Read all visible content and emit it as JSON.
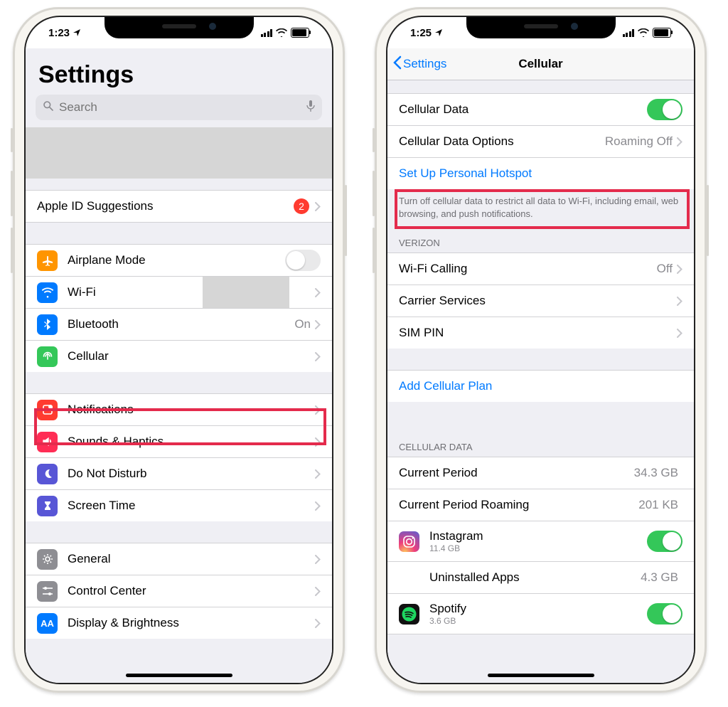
{
  "left": {
    "time": "1:23",
    "title": "Settings",
    "search_placeholder": "Search",
    "apple_id": {
      "label": "Apple ID Suggestions",
      "badge": "2"
    },
    "group1": [
      {
        "icon": "airplane",
        "color": "#ff9500",
        "label": "Airplane Mode",
        "type": "toggle",
        "on": false
      },
      {
        "icon": "wifi",
        "color": "#007aff",
        "label": "Wi-Fi",
        "type": "grey"
      },
      {
        "icon": "bluetooth",
        "color": "#007aff",
        "label": "Bluetooth",
        "type": "disclose",
        "value": "On"
      },
      {
        "icon": "cellular",
        "color": "#34c759",
        "label": "Cellular",
        "type": "disclose",
        "highlight": true
      }
    ],
    "group2": [
      {
        "icon": "notify",
        "color": "#ff3b30",
        "label": "Notifications"
      },
      {
        "icon": "sounds",
        "color": "#ff2d55",
        "label": "Sounds & Haptics"
      },
      {
        "icon": "moon",
        "color": "#5856d6",
        "label": "Do Not Disturb"
      },
      {
        "icon": "hourglass",
        "color": "#5856d6",
        "label": "Screen Time"
      }
    ],
    "group3": [
      {
        "icon": "gear",
        "color": "#8e8e93",
        "label": "General"
      },
      {
        "icon": "sliders",
        "color": "#8e8e93",
        "label": "Control Center"
      },
      {
        "icon": "aa",
        "color": "#007aff",
        "label": "Display & Brightness"
      }
    ]
  },
  "right": {
    "time": "1:25",
    "back": "Settings",
    "title": "Cellular",
    "row1": {
      "label": "Cellular Data",
      "on": true
    },
    "row2": {
      "label": "Cellular Data Options",
      "value": "Roaming Off",
      "highlight": true
    },
    "row3": {
      "label": "Set Up Personal Hotspot"
    },
    "note": "Turn off cellular data to restrict all data to Wi-Fi, including email, web browsing, and push notifications.",
    "carrier_header": "VERIZON",
    "carrier_rows": [
      {
        "label": "Wi-Fi Calling",
        "value": "Off"
      },
      {
        "label": "Carrier Services"
      },
      {
        "label": "SIM PIN"
      }
    ],
    "add_plan": "Add Cellular Plan",
    "usage_header": "CELLULAR DATA",
    "usage": [
      {
        "label": "Current Period",
        "value": "34.3 GB"
      },
      {
        "label": "Current Period Roaming",
        "value": "201 KB"
      }
    ],
    "apps": [
      {
        "name": "Instagram",
        "usage": "11.4 GB",
        "icon": "instagram",
        "on": true
      },
      {
        "name": "Uninstalled Apps",
        "usage": "4.3 GB",
        "indent": true
      },
      {
        "name": "Spotify",
        "usage": "3.6 GB",
        "icon": "spotify",
        "on": true
      }
    ]
  }
}
